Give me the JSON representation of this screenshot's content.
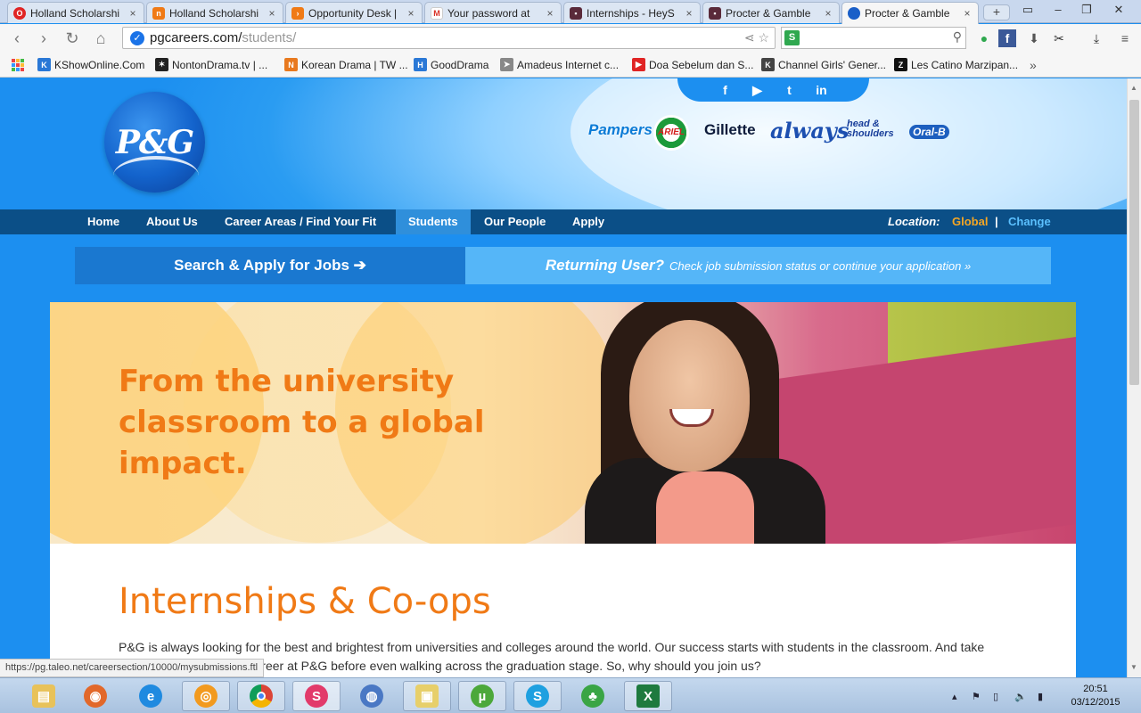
{
  "browser": {
    "tabs": [
      {
        "label": "Holland Scholarshi",
        "icon": "opera-icon",
        "color": "#e02424",
        "glyph": "O"
      },
      {
        "label": "Holland Scholarshi",
        "icon": "n-site-icon",
        "color": "#f07a16",
        "glyph": "n"
      },
      {
        "label": "Opportunity Desk |",
        "icon": "opportunity-desk-icon",
        "color": "#f07a16",
        "glyph": "›"
      },
      {
        "label": "Your password at",
        "icon": "gmail-icon",
        "color": "#d93025",
        "glyph": "M"
      },
      {
        "label": "Internships - HeyS",
        "icon": "heys-icon",
        "color": "#5a2a3a",
        "glyph": "▪"
      },
      {
        "label": "Procter & Gamble",
        "icon": "heys-icon",
        "color": "#5a2a3a",
        "glyph": "▪"
      },
      {
        "label": "Procter & Gamble",
        "icon": "pg-icon",
        "color": "#1a5fc8",
        "glyph": "●"
      }
    ],
    "url_host": "pgcareers.com/",
    "url_path": "students/",
    "status_url": "https://pg.taleo.net/careersection/10000/mysubmissions.ftl"
  },
  "bookmarks": [
    {
      "label": "KShowOnline.Com",
      "color": "#2a78d6",
      "glyph": "K"
    },
    {
      "label": "NontonDrama.tv | ...",
      "color": "#222222",
      "glyph": "✶"
    },
    {
      "label": "Korean Drama | TW ...",
      "color": "#e8791e",
      "glyph": "N"
    },
    {
      "label": "GoodDrama",
      "color": "#2a78d6",
      "glyph": "H"
    },
    {
      "label": "Amadeus Internet c...",
      "color": "#555555",
      "glyph": "➤"
    },
    {
      "label": "Doa Sebelum dan S...",
      "color": "#e02424",
      "glyph": "▶"
    },
    {
      "label": "Channel Girls' Gener...",
      "color": "#444444",
      "glyph": "K"
    },
    {
      "label": "Les Catino Marzipan...",
      "color": "#111111",
      "glyph": "Z"
    }
  ],
  "site": {
    "logo": "P&G",
    "brands": [
      "Pampers",
      "ARIEL",
      "Gillette",
      "always",
      "head & shoulders",
      "Oral-B"
    ],
    "social": [
      "f",
      "▶",
      "t",
      "in"
    ],
    "nav": [
      "Home",
      "About Us",
      "Career Areas / Find Your Fit",
      "Students",
      "Our People",
      "Apply"
    ],
    "active_nav": "Students",
    "location_label": "Location:",
    "location_value": "Global",
    "location_sep": "|",
    "location_change": "Change",
    "cta_search": "Search & Apply for Jobs ➔",
    "cta_returning_title": "Returning User?",
    "cta_returning_text": "Check job submission status or continue your application »",
    "hero_text": "From the university classroom to a global impact.",
    "section_title": "Internships & Co-ops",
    "section_body": "P&G is always looking for the best and brightest from universities and colleges around the world. Our success starts with students in the classroom. And take your first step toward a career at P&G before even walking across the graduation stage. So, why should you join us?"
  },
  "taskbar": {
    "apps": [
      "file-explorer-icon",
      "firefox-like-icon",
      "internet-explorer-icon",
      "media-player-icon",
      "chrome-icon",
      "app-swirl-icon",
      "chromium-icon",
      "folder-icon",
      "utorrent-icon",
      "skype-icon",
      "clover-icon",
      "excel-icon"
    ],
    "time": "20:51",
    "date": "03/12/2015"
  }
}
